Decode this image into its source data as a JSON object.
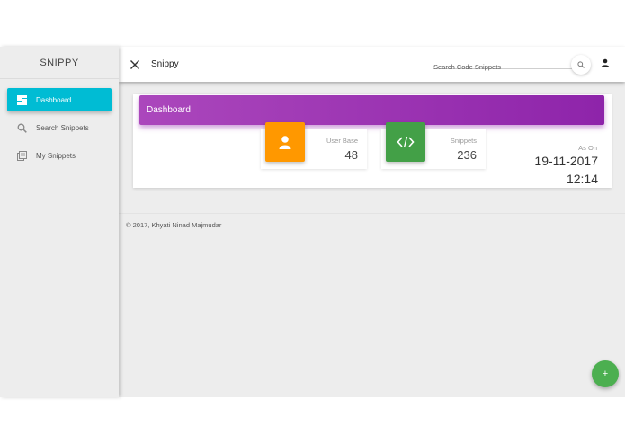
{
  "sidebar": {
    "brand": "SNIPPY",
    "items": [
      {
        "label": "Dashboard",
        "icon": "dashboard-icon",
        "active": true
      },
      {
        "label": "Search Snippets",
        "icon": "search-icon",
        "active": false
      },
      {
        "label": "My Snippets",
        "icon": "library-icon",
        "active": false
      }
    ]
  },
  "topbar": {
    "title": "Snippy",
    "search_placeholder": "Search Code Snippets"
  },
  "dashboard": {
    "title": "Dashboard",
    "stats": [
      {
        "label": "User Base",
        "value": "48",
        "icon": "person-icon",
        "color": "#ff9800"
      },
      {
        "label": "Snippets",
        "value": "236",
        "icon": "code-icon",
        "color": "#43a047"
      }
    ],
    "asof": {
      "label": "As On",
      "date": "19-11-2017",
      "time": "12:14"
    }
  },
  "footer": {
    "text": "© 2017, Khyati Ninad Majmudar"
  },
  "fab": {
    "label": "+",
    "color": "#4caf50"
  },
  "colors": {
    "accent": "#00bcd4",
    "header_purple": "#9c27b0"
  }
}
